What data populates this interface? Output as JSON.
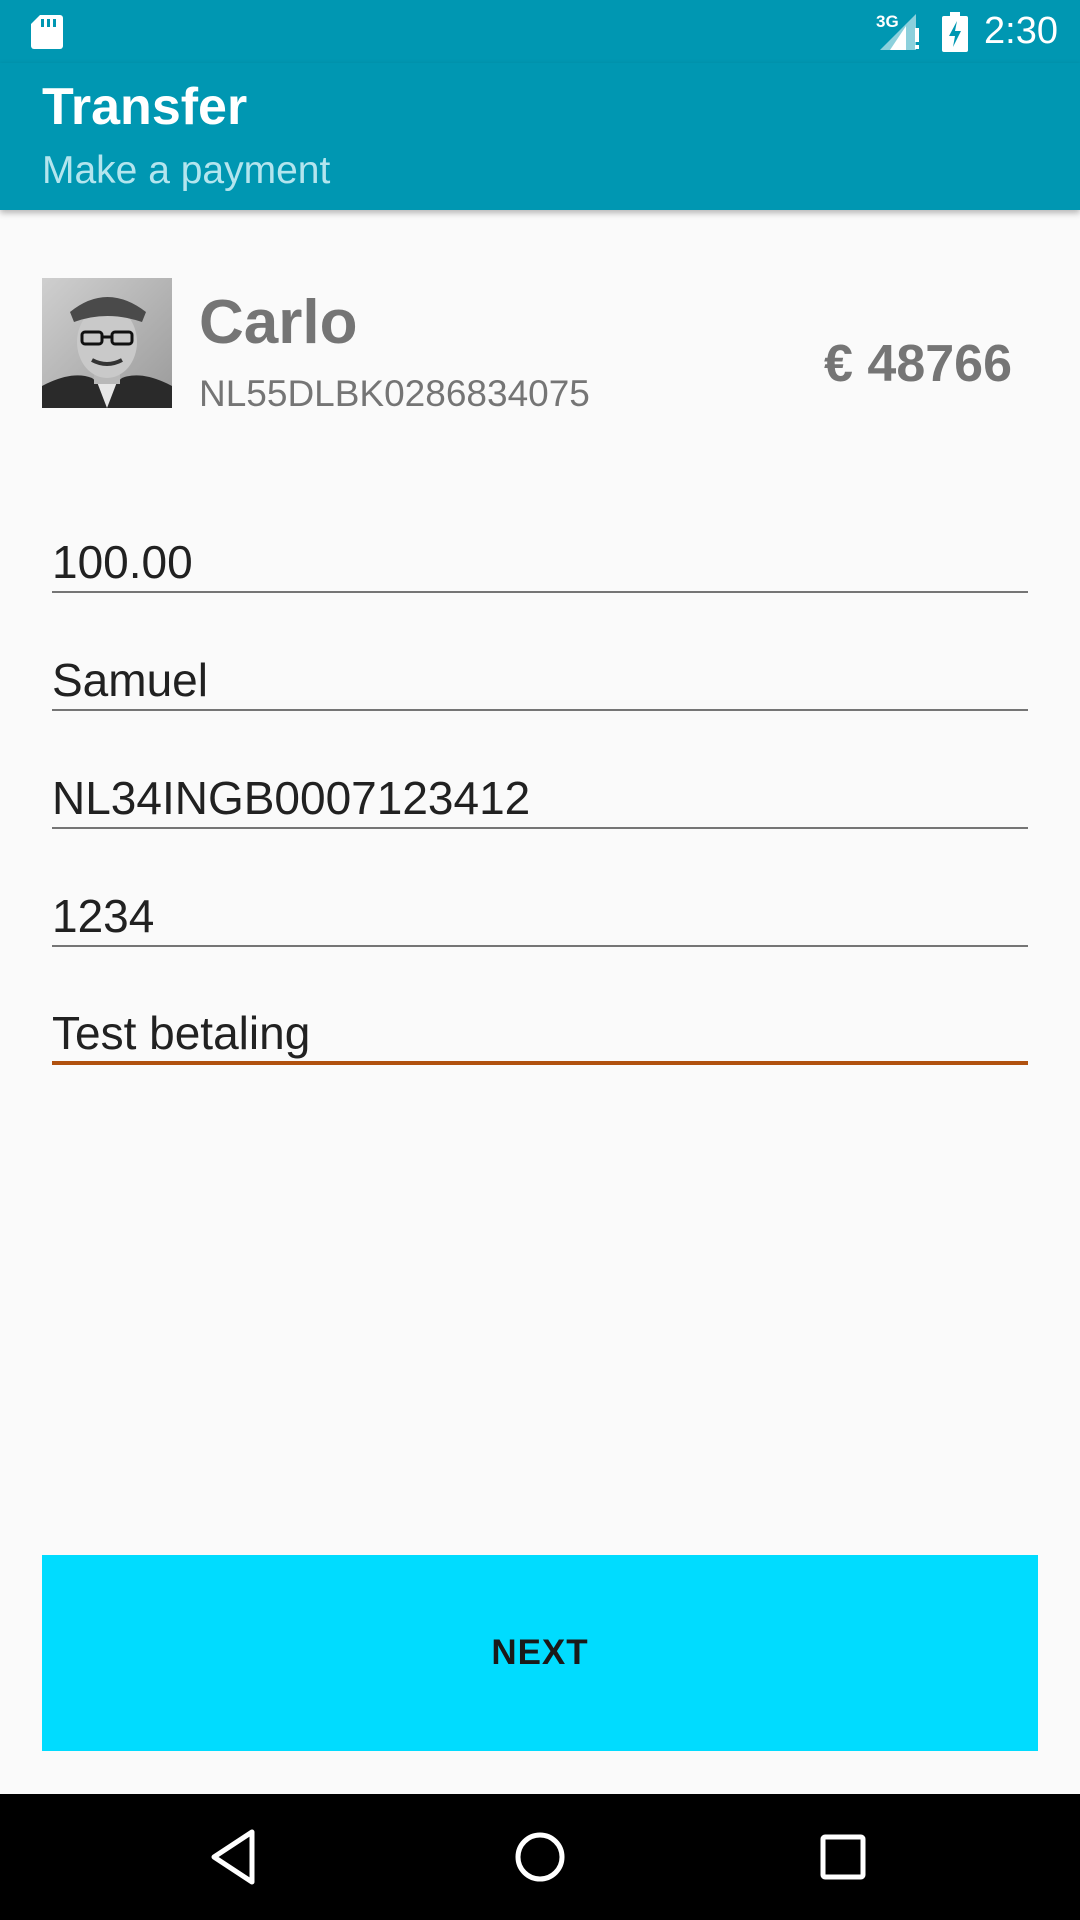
{
  "status_bar": {
    "time": "2:30",
    "network": "3G",
    "icons": [
      "sd-card-icon",
      "signal-icon",
      "battery-charging-icon"
    ]
  },
  "app_bar": {
    "title": "Transfer",
    "subtitle": "Make a payment",
    "color": "#0097b2"
  },
  "account": {
    "name": "Carlo",
    "iban": "NL55DLBK0286834075",
    "balance": "€ 48766"
  },
  "form": {
    "amount": "100.00",
    "recipient_name": "Samuel",
    "recipient_iban": "NL34INGB0007123412",
    "code": "1234",
    "description": "Test betaling"
  },
  "actions": {
    "next_label": "NEXT",
    "next_color": "#00dcff"
  },
  "nav_bar": {
    "icons": [
      "back-icon",
      "home-icon",
      "recents-icon"
    ]
  }
}
